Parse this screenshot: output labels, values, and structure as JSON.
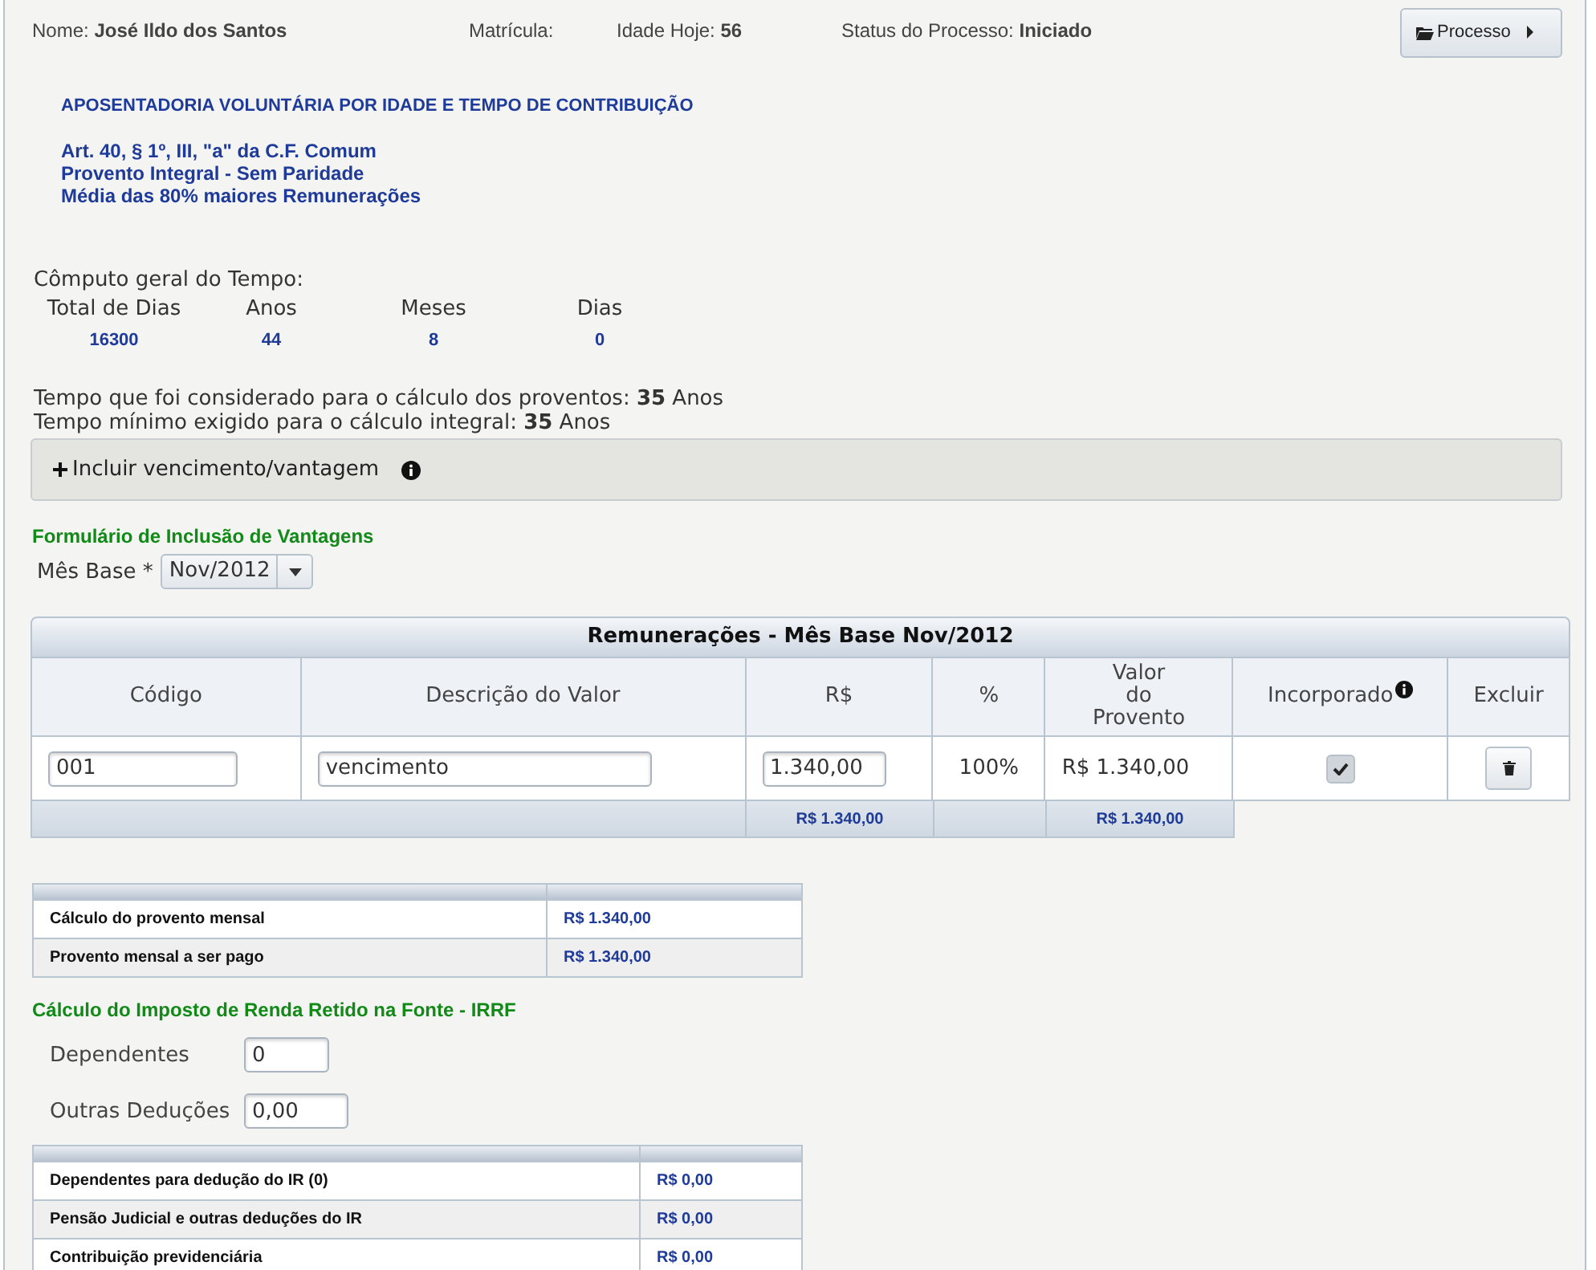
{
  "header": {
    "name": "Nome: **José Ildo dos Santos**",
    "matricula": "Matrícula:",
    "idade": "Idade Hoje: **56**",
    "status": "Status do Processo: **Iniciado**",
    "button": "Processo"
  },
  "regime": {
    "title": "APOSENTADORIA VOLUNTÁRIA POR IDADE E TEMPO DE CONTRIBUIÇÃO",
    "lines": [
      "Art. 40, § 1º, III, \"a\" da C.F. Comum",
      "Provento Integral - Sem Paridade",
      "Média das 80% maiores Remunerações"
    ]
  },
  "computo": {
    "title": "Cômputo geral do Tempo:",
    "columns": [
      {
        "label": "Total de Dias",
        "value": "16300"
      },
      {
        "label": "Anos",
        "value": "44"
      },
      {
        "label": "Meses",
        "value": "8"
      },
      {
        "label": "Dias",
        "value": "0"
      }
    ]
  },
  "tempo": [
    "Tempo que foi considerado para o cálculo dos proventos: **35** Anos",
    "Tempo mínimo exigido para o cálculo integral: **35** Anos"
  ],
  "include_panel": {
    "label": "Incluir vencimento/vantagem"
  },
  "form": {
    "title": "Formulário de Inclusão de Vantagens",
    "mes_base_label": "Mês Base *",
    "mes_base": "Nov/2012"
  },
  "remuneracoes": {
    "title": "Remunerações - Mês Base Nov/2012",
    "columns": [
      "Código",
      "Descrição do Valor",
      "R$",
      "%",
      "Valor\ndo\nProvento",
      "Incorporado",
      "Excluir"
    ],
    "rows": [
      {
        "codigo": "001",
        "descricao": "vencimento",
        "valor": "1.340,00",
        "percent": "100%",
        "valor_provento": "R$ 1.340,00",
        "incorporado": true
      }
    ],
    "totals": [
      "R$ 1.340,00",
      "R$ 1.340,00"
    ]
  },
  "summary": [
    {
      "label": "Cálculo do provento mensal",
      "value": "R$ 1.340,00"
    },
    {
      "label": "Provento mensal a ser pago",
      "value": "R$ 1.340,00"
    }
  ],
  "irrf": {
    "title": "Cálculo do Imposto de Renda Retido na Fonte - IRRF",
    "fields": [
      {
        "label": "Dependentes",
        "value": "0"
      },
      {
        "label": "Outras Deduções",
        "value": "0,00"
      }
    ],
    "rows": [
      {
        "label": "Dependentes para dedução do IR (0)",
        "value": "R$ 0,00"
      },
      {
        "label": "Pensão Judicial e outras deduções do IR",
        "value": "R$ 0,00"
      },
      {
        "label": "Contribuição previdenciária",
        "value": "R$ 0,00"
      }
    ]
  }
}
